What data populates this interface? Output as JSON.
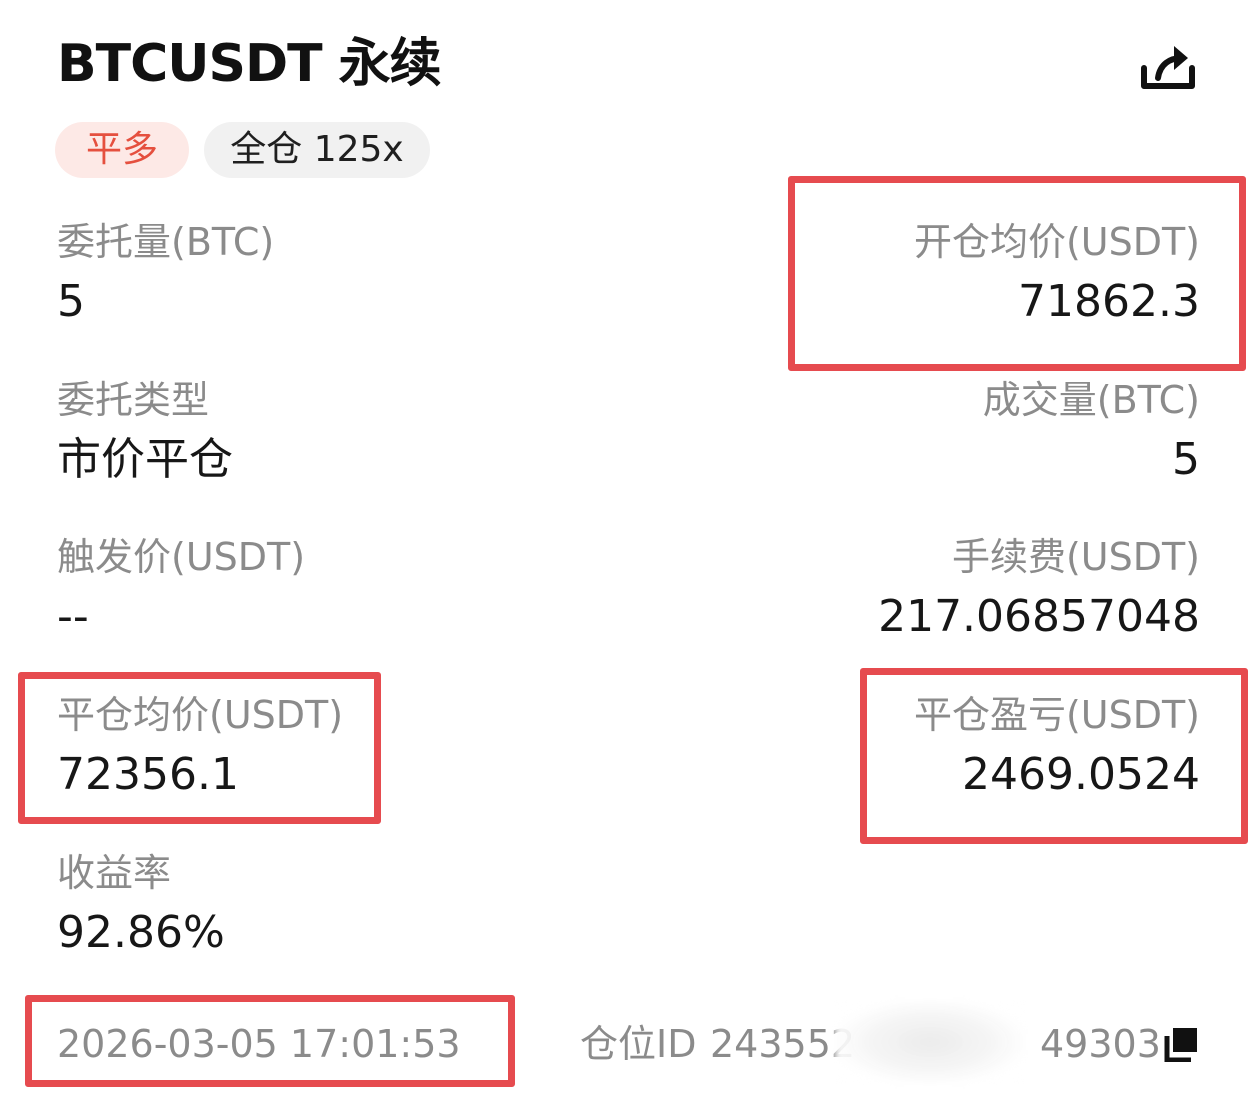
{
  "header": {
    "title": "BTCUSDT 永续",
    "share_icon": "share-icon"
  },
  "badges": {
    "side": "平多",
    "margin_mode": "全仓 125x"
  },
  "fields": {
    "order_qty": {
      "label": "委托量(BTC)",
      "value": "5"
    },
    "open_avg_price": {
      "label": "开仓均价(USDT)",
      "value": "71862.3"
    },
    "order_type": {
      "label": "委托类型",
      "value": "市价平仓"
    },
    "filled_qty": {
      "label": "成交量(BTC)",
      "value": "5"
    },
    "trigger_price": {
      "label": "触发价(USDT)",
      "value": "--"
    },
    "fee": {
      "label": "手续费(USDT)",
      "value": "217.06857048"
    },
    "close_avg_price": {
      "label": "平仓均价(USDT)",
      "value": "72356.1"
    },
    "close_pnl": {
      "label": "平仓盈亏(USDT)",
      "value": "2469.0524"
    },
    "roi": {
      "label": "收益率",
      "value": "92.86%"
    }
  },
  "footer": {
    "timestamp": "2026-03-05 17:01:53",
    "position_id_label": "仓位ID",
    "position_id_prefix": "243552",
    "position_id_suffix": "49303",
    "copy_icon": "copy-icon"
  },
  "colors": {
    "highlight": "#e64b4f",
    "side_badge_bg": "#fde9e6",
    "side_badge_text": "#e5503f",
    "mode_badge_bg": "#f1f1f1"
  }
}
